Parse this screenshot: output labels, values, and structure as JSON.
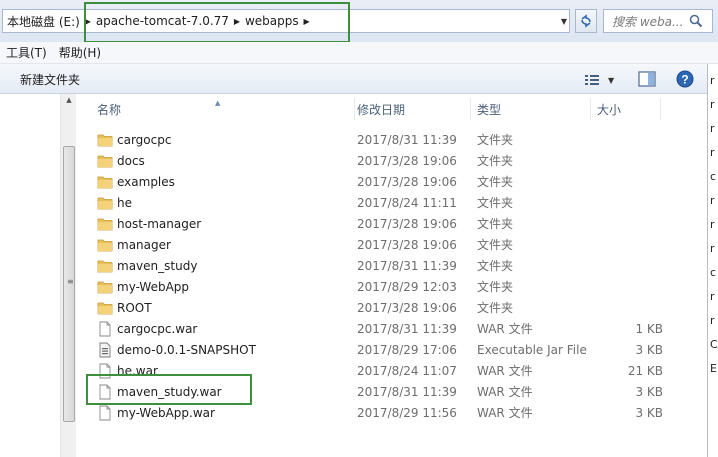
{
  "address": {
    "root": "本地磁盘 (E:)",
    "seg1": "apache-tomcat-7.0.77",
    "seg2": "webapps"
  },
  "search": {
    "placeholder": "搜索 weba..."
  },
  "menu": {
    "tools": "工具(T)",
    "help": "帮助(H)"
  },
  "toolbar": {
    "new_folder": "新建文件夹"
  },
  "columns": {
    "name": "名称",
    "date": "修改日期",
    "type": "类型",
    "size": "大小"
  },
  "files": [
    {
      "name": "cargocpc",
      "date": "2017/8/31 11:39",
      "type": "文件夹",
      "size": "",
      "icon": "folder-icon"
    },
    {
      "name": "docs",
      "date": "2017/3/28 19:06",
      "type": "文件夹",
      "size": "",
      "icon": "folder-icon"
    },
    {
      "name": "examples",
      "date": "2017/3/28 19:06",
      "type": "文件夹",
      "size": "",
      "icon": "folder-icon"
    },
    {
      "name": "he",
      "date": "2017/8/24 11:11",
      "type": "文件夹",
      "size": "",
      "icon": "folder-icon"
    },
    {
      "name": "host-manager",
      "date": "2017/3/28 19:06",
      "type": "文件夹",
      "size": "",
      "icon": "folder-icon"
    },
    {
      "name": "manager",
      "date": "2017/3/28 19:06",
      "type": "文件夹",
      "size": "",
      "icon": "folder-icon"
    },
    {
      "name": "maven_study",
      "date": "2017/8/31 11:39",
      "type": "文件夹",
      "size": "",
      "icon": "folder-icon"
    },
    {
      "name": "my-WebApp",
      "date": "2017/8/29 12:03",
      "type": "文件夹",
      "size": "",
      "icon": "folder-icon"
    },
    {
      "name": "ROOT",
      "date": "2017/3/28 19:06",
      "type": "文件夹",
      "size": "",
      "icon": "folder-icon"
    },
    {
      "name": "cargocpc.war",
      "date": "2017/8/31 11:39",
      "type": "WAR 文件",
      "size": "1 KB",
      "icon": "file-icon"
    },
    {
      "name": "demo-0.0.1-SNAPSHOT",
      "date": "2017/8/29 17:06",
      "type": "Executable Jar File",
      "size": "3 KB",
      "icon": "jar-icon"
    },
    {
      "name": "he.war",
      "date": "2017/8/24 11:07",
      "type": "WAR 文件",
      "size": "21 KB",
      "icon": "file-icon"
    },
    {
      "name": "maven_study.war",
      "date": "2017/8/31 11:39",
      "type": "WAR 文件",
      "size": "3 KB",
      "icon": "file-icon"
    },
    {
      "name": "my-WebApp.war",
      "date": "2017/8/29 11:56",
      "type": "WAR 文件",
      "size": "3 KB",
      "icon": "file-icon"
    }
  ],
  "background_window_chars": [
    "r",
    "r",
    "r",
    "r",
    "c",
    "r",
    "r",
    "r",
    "c",
    "r",
    "r",
    "C",
    "E"
  ],
  "colors": {
    "highlight": "#3c8f3c",
    "folder": "#e8c05a",
    "accent": "#3a6ea5"
  }
}
